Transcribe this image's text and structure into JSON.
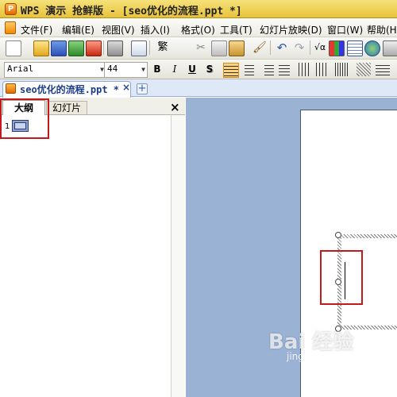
{
  "window": {
    "title": "WPS 演示 抢鲜版 - [seo优化的流程.ppt *]",
    "app_icon_letter": "P"
  },
  "menu": {
    "items": [
      "文件(F)",
      "编辑(E)",
      "视图(V)",
      "插入(I)",
      "格式(O)",
      "工具(T)",
      "幻灯片放映(D)",
      "窗口(W)",
      "帮助(H)"
    ]
  },
  "toolbar": {
    "traditional_label": "繁",
    "formula_label": "√α"
  },
  "format_bar": {
    "font_family": "Arial",
    "font_size": "44",
    "bold_label": "B",
    "italic_label": "I",
    "underline_label": "U",
    "shadow_label": "S"
  },
  "document_tab": {
    "label": "seo优化的流程.ppt *",
    "close_label": "×",
    "new_tab_label": "+"
  },
  "left_panel": {
    "tab_outline": "大纲",
    "tab_slides": "幻灯片",
    "close_label": "×",
    "slide_number": "1"
  },
  "watermark": {
    "brand": "Bai 经验",
    "url": "jingyan.baidu.com"
  },
  "colors": {
    "highlight": "#c3191d",
    "workspace": "#9ab2d4",
    "titlebar": "#e8c33a"
  }
}
